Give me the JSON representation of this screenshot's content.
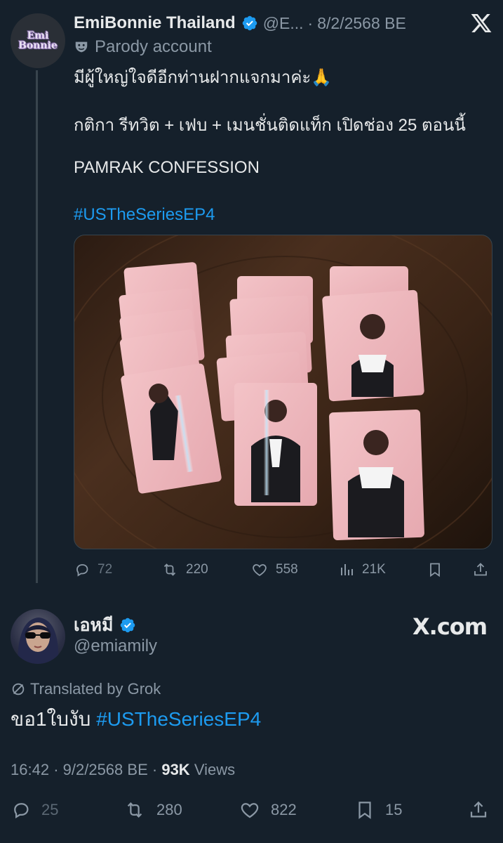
{
  "tweet": {
    "display_name": "EmiBonnie Thailand",
    "handle": "@E...",
    "separator": "·",
    "date": "8/2/2568 BE",
    "badge": "Parody account",
    "logo_text_top": "Emi",
    "logo_text_bottom": "Bonnie",
    "lines": [
      "มีผู้ใหญ่ใจดีอีกท่านฝากแจกมาค่ะ🙏",
      "กติกา รีทวิต + เฟบ + เมนชั่นติดแท็ก เปิดช่อง 25 ตอนนี้",
      "PAMRAK CONFESSION"
    ],
    "hashtag": "#USTheSeriesEP4",
    "stats": {
      "replies": "72",
      "reposts": "220",
      "likes": "558",
      "views": "21K"
    }
  },
  "reply": {
    "display_name": "เอหมี",
    "handle": "@emiamily",
    "watermark": "X.com",
    "translated_label": "Translated by Grok",
    "text": "ขอ1ใบงับ",
    "hashtag": "#USTheSeriesEP4",
    "time": "16:42",
    "date": "9/2/2568 BE",
    "views_count": "93K",
    "views_label": "Views",
    "stats": {
      "replies": "25",
      "reposts": "280",
      "likes": "822",
      "bookmarks": "15"
    }
  },
  "colors": {
    "background": "#15202b",
    "text": "#e7e9ea",
    "secondary": "#8b98a5",
    "link": "#1d9bf0",
    "verified": "#1d9bf0"
  },
  "icons": [
    "verified-icon",
    "x-logo-icon",
    "parody-mask-icon",
    "reply-icon",
    "repost-icon",
    "like-icon",
    "views-icon",
    "bookmark-icon",
    "share-icon",
    "translate-icon"
  ]
}
